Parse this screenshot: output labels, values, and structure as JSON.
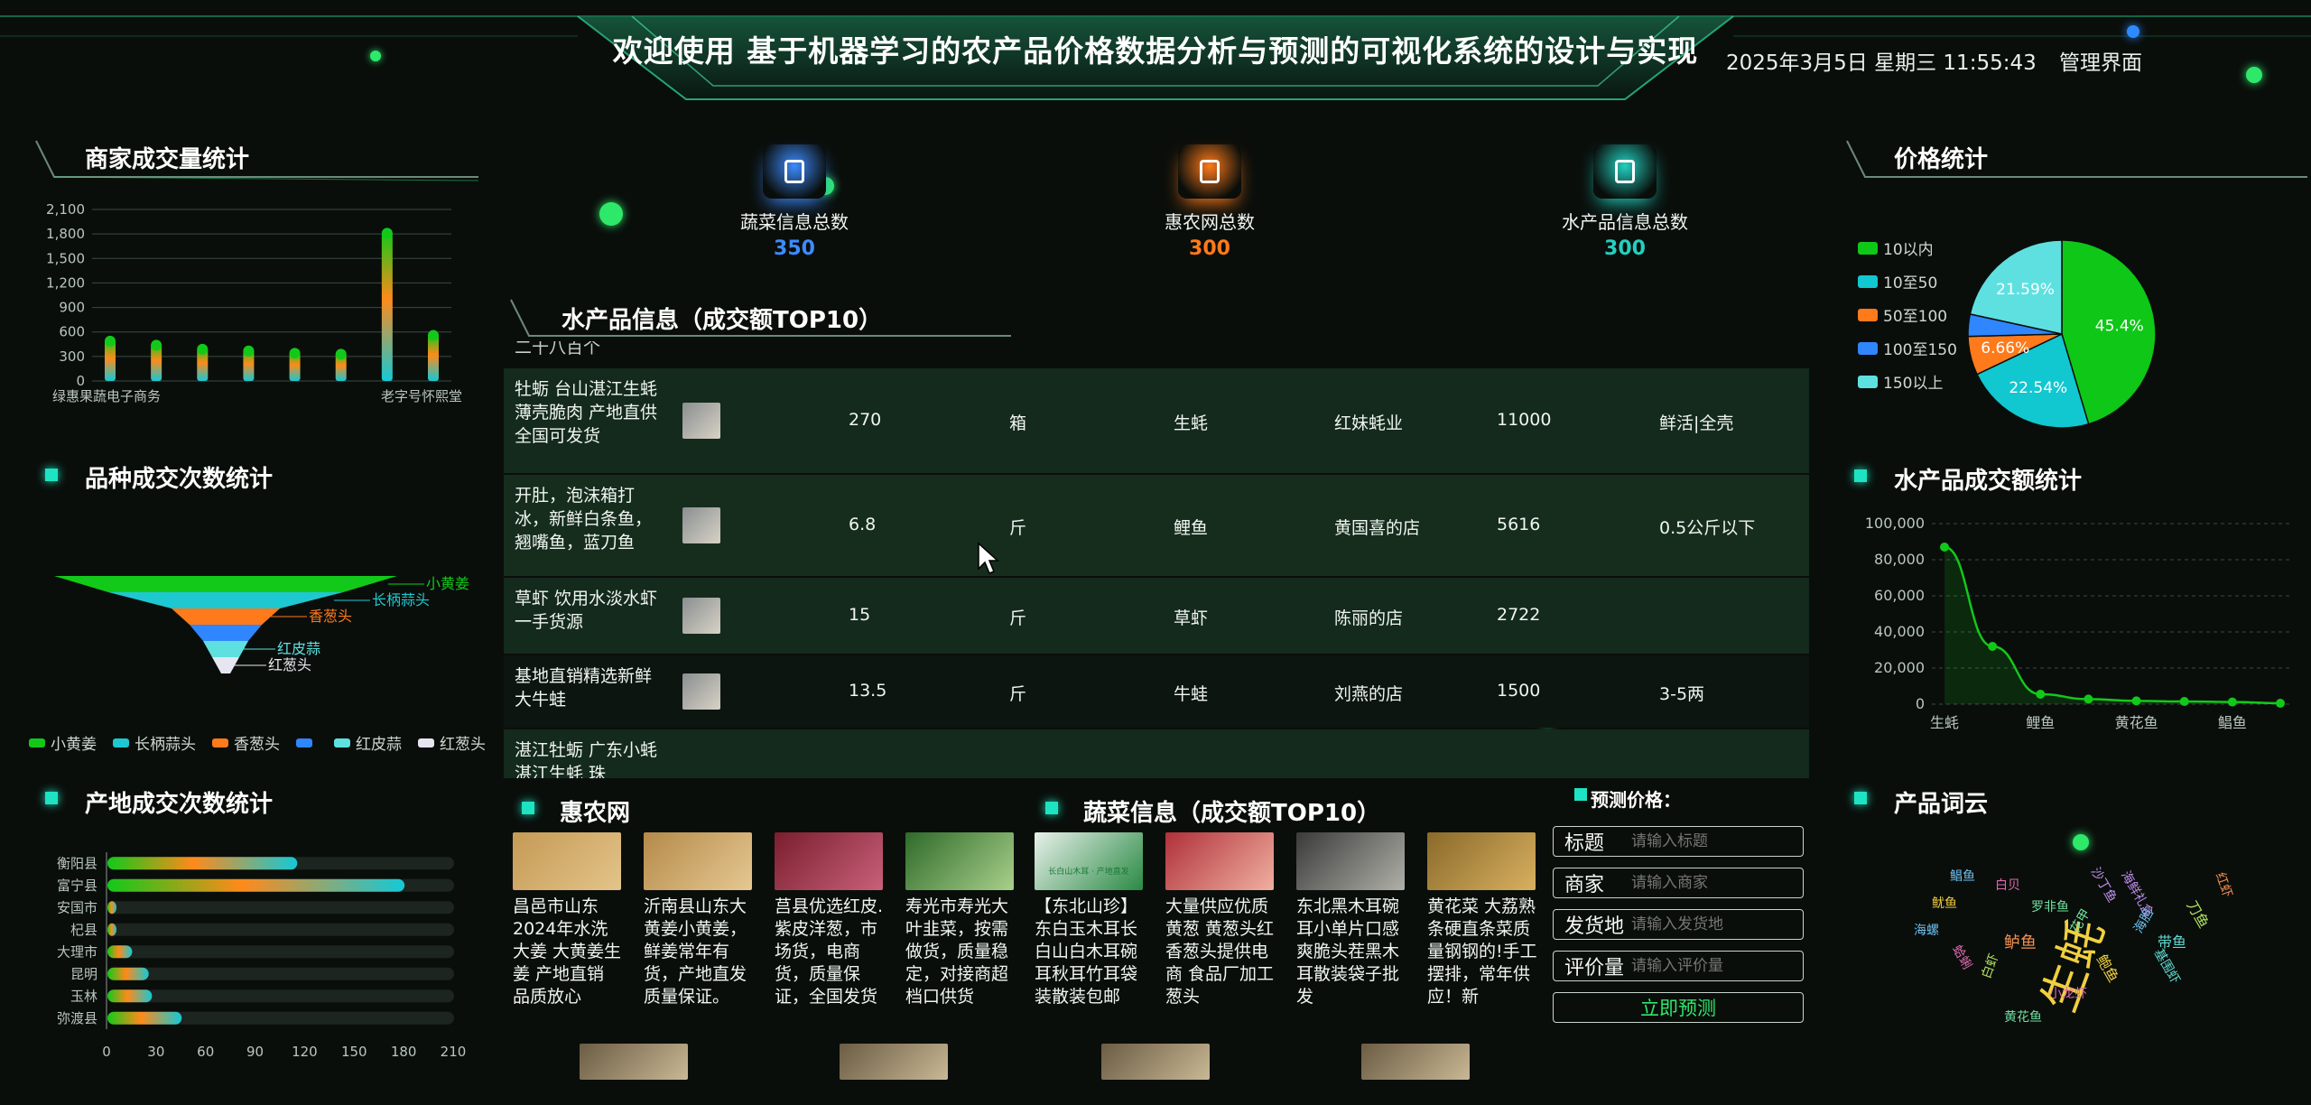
{
  "header": {
    "title": "欢迎使用 基于机器学习的农产品价格数据分析与预测的可视化系统的设计与实现",
    "datetime": "2025年3月5日 星期三 11:55:43",
    "admin_link": "管理界面"
  },
  "stats": [
    {
      "label": "蔬菜信息总数",
      "value": "350",
      "color": "#3d8bff",
      "icon": "thermometer-icon"
    },
    {
      "label": "惠农网总数",
      "value": "300",
      "color": "#ff7a1a",
      "icon": "water-drop-icon"
    },
    {
      "label": "水产品信息总数",
      "value": "300",
      "color": "#22d0c0",
      "icon": "clipboard-icon"
    }
  ],
  "merchant_chart": {
    "title": "商家成交量统计",
    "chart_data": {
      "type": "bar",
      "categories": [
        "绿惠果蔬电子商务",
        "",
        "",
        "",
        "",
        "",
        "",
        "",
        "老字号怀熙堂"
      ],
      "values": [
        510,
        460,
        410,
        390,
        360,
        350,
        1830,
        580
      ],
      "ylim": [
        0,
        2100
      ],
      "yticks": [
        "0",
        "300",
        "600",
        "900",
        "1,200",
        "1,500",
        "1,800",
        "2,100"
      ]
    }
  },
  "variety_chart": {
    "title": "品种成交次数统计",
    "chart_data": {
      "type": "funnel",
      "labels": [
        "小黄姜",
        "长柄蒜头",
        "香葱头",
        "",
        "红皮蒜",
        "红葱头"
      ],
      "legend": [
        "小黄姜",
        "长柄蒜头",
        "香葱头",
        "",
        "红皮蒜",
        "红葱头"
      ],
      "colors": [
        "#12c91a",
        "#1ec8d0",
        "#ff7a1a",
        "#2f86ff",
        "#5fe0e0",
        "#e6e6f0"
      ]
    }
  },
  "origin_chart": {
    "title": "产地成交次数统计",
    "chart_data": {
      "type": "bar",
      "categories": [
        "衡阳县",
        "富宁县",
        "安国市",
        "杞县",
        "大理市",
        "昆明",
        "玉林",
        "弥渡县"
      ],
      "values": [
        115,
        180,
        4,
        4,
        15,
        25,
        27,
        45
      ],
      "xlim": [
        0,
        210
      ],
      "xticks": [
        "0",
        "30",
        "60",
        "90",
        "120",
        "150",
        "180",
        "210"
      ]
    }
  },
  "aquatic_table": {
    "title": "水产品信息（成交额TOP10）",
    "top_partial": "二十八百个",
    "rows": [
      {
        "name": "牡蛎 台山湛江生蚝薄壳脆肉 产地直供全国可发货",
        "price": "270",
        "unit": "箱",
        "variety": "生蚝",
        "shop": "红妹蚝业",
        "amount": "11000",
        "spec": "鲜活|全壳"
      },
      {
        "name": "开肚，泡沫箱打冰，新鲜白条鱼，翘嘴鱼，蓝刀鱼",
        "price": "6.8",
        "unit": "斤",
        "variety": "鲤鱼",
        "shop": "黄国喜的店",
        "amount": "5616",
        "spec": "0.5公斤以下"
      },
      {
        "name": "草虾 饮用水淡水虾一手货源",
        "price": "15",
        "unit": "斤",
        "variety": "草虾",
        "shop": "陈丽的店",
        "amount": "2722",
        "spec": ""
      },
      {
        "name": "基地直销精选新鲜大牛蛙",
        "price": "13.5",
        "unit": "斤",
        "variety": "牛蛙",
        "shop": "刘燕的店",
        "amount": "1500",
        "spec": "3-5两"
      },
      {
        "name": "湛江牡蛎 广东小蚝 湛江生蚝 珠",
        "price": "",
        "unit": "",
        "variety": "",
        "shop": "",
        "amount": "",
        "spec": ""
      }
    ]
  },
  "huinong": {
    "title": "惠农网",
    "cards": [
      {
        "text": "昌邑市山东2024年水洗大姜 大黄姜生姜 产地直销 品质放心"
      },
      {
        "text": "沂南县山东大黄姜小黄姜，鲜姜常年有货，产地直发质量保证。"
      },
      {
        "text": "莒县优选红皮.紫皮洋葱，市场货，电商货，质量保证，全国发货"
      },
      {
        "text": "寿光市寿光大叶韭菜，按需做货，质量稳定，对接商超档口供货"
      }
    ]
  },
  "vegetable": {
    "title": "蔬菜信息（成交额TOP10）",
    "cards": [
      {
        "text": "【东北山珍】东白玉木耳长白山白木耳碗耳秋耳竹耳袋装散装包邮"
      },
      {
        "text": "大量供应优质黄葱 黄葱头红香葱头提供电商 食品厂加工葱头"
      },
      {
        "text": "东北黑木耳碗耳小单片口感爽脆头茬黑木耳散装袋子批发"
      },
      {
        "text": "黄花菜 大荔熟条硬直条菜质量钢钢的!手工摆排，常年供应！新"
      }
    ],
    "img_banner": "长白山木耳 · 产地直发"
  },
  "predict": {
    "title": "预测价格：",
    "fields": [
      {
        "label": "标题",
        "placeholder": "请输入标题"
      },
      {
        "label": "商家",
        "placeholder": "请输入商家"
      },
      {
        "label": "发货地",
        "placeholder": "请输入发货地"
      },
      {
        "label": "评价量",
        "placeholder": "请输入评价量"
      }
    ],
    "submit": "立即预测"
  },
  "price_chart": {
    "title": "价格统计",
    "chart_data": {
      "type": "pie",
      "labels": [
        "10以内",
        "10至50",
        "50至100",
        "100至150",
        "150以上"
      ],
      "values": [
        45.4,
        22.54,
        6.66,
        3.81,
        21.59
      ],
      "data_labels": [
        "45.4%",
        "22.54%",
        "6.66%",
        "",
        "21.59%"
      ],
      "colors": [
        "#0fc717",
        "#11c7d0",
        "#ff7a1a",
        "#2f86ff",
        "#5fe0e0"
      ]
    }
  },
  "aquatic_amount_chart": {
    "title": "水产品成交额统计",
    "chart_data": {
      "type": "line",
      "categories": [
        "生蚝",
        "",
        "鲤鱼",
        "",
        "黄花鱼",
        "",
        "鲳鱼",
        ""
      ],
      "values": [
        87000,
        32000,
        5500,
        2800,
        1800,
        1500,
        1200,
        500
      ],
      "ylim": [
        0,
        100000
      ],
      "yticks": [
        "0",
        "20,000",
        "40,000",
        "60,000",
        "80,000",
        "100,000"
      ]
    }
  },
  "word_cloud": {
    "title": "产品词云",
    "words": [
      "生蚝",
      "鲳鱼",
      "白贝",
      "罗非鱼",
      "海鲜礼盒",
      "鲈鱼",
      "带鱼",
      "刀鱼",
      "鱿鱼",
      "海螺",
      "小龙虾",
      "黄花鱼",
      "沙丁鱼",
      "红虾",
      "基围虾",
      "白虾",
      "鲍鱼",
      "海胆",
      "蛤蜊",
      "花甲"
    ]
  }
}
